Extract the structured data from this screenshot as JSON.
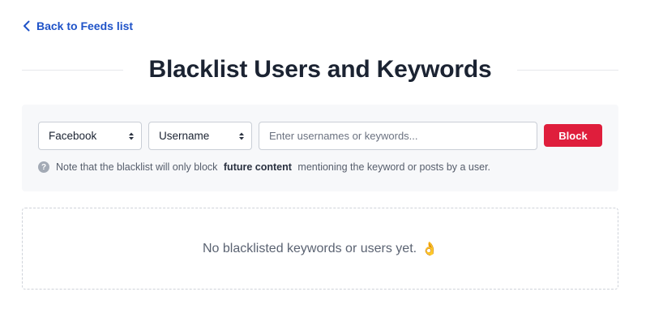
{
  "header": {
    "back_link_label": "Back to Feeds list",
    "title": "Blacklist Users and Keywords"
  },
  "form": {
    "platform_select": {
      "selected": "Facebook"
    },
    "type_select": {
      "selected": "Username"
    },
    "search": {
      "placeholder": "Enter usernames or keywords...",
      "value": ""
    },
    "block_button_label": "Block",
    "note": {
      "prefix": "Note that the blacklist will only block",
      "emphasis": "future content",
      "suffix": "mentioning the keyword or posts by a user."
    }
  },
  "empty_state": {
    "message": "No blacklisted keywords or users yet.",
    "emoji": "👌"
  },
  "colors": {
    "link": "#1f53c8",
    "block_button": "#df1e3c",
    "panel_bg": "#f7f8fa"
  }
}
